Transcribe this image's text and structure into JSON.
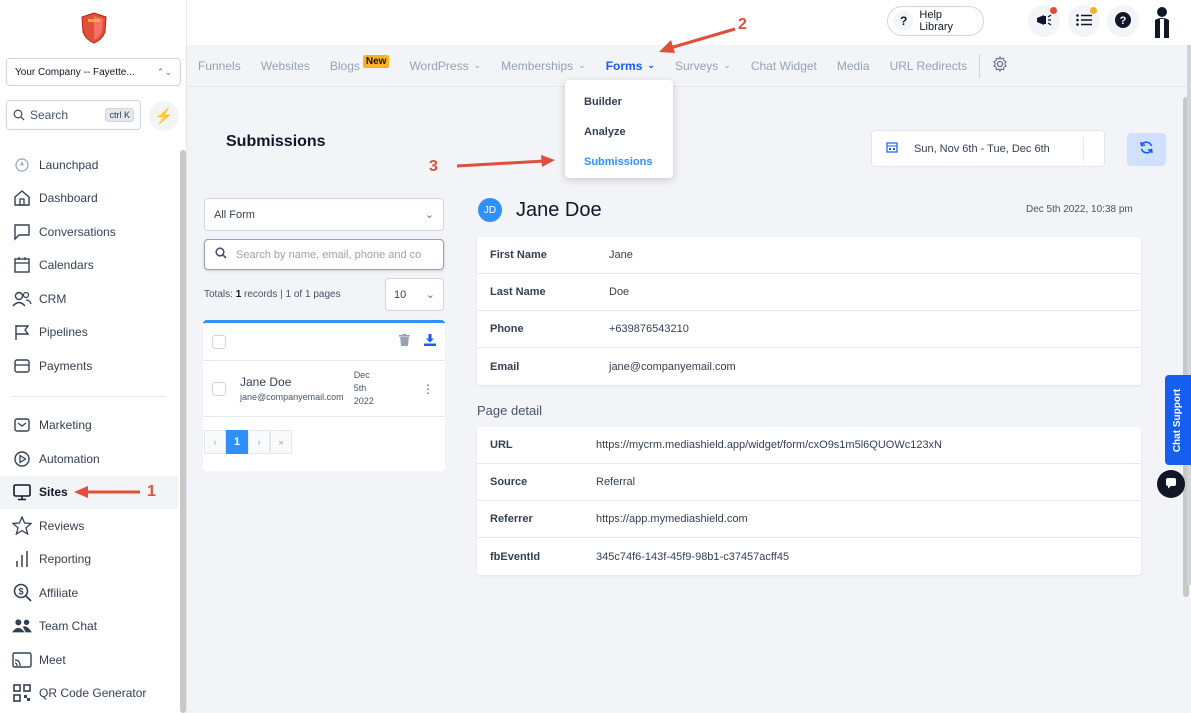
{
  "company": {
    "name": "Your Company -- Fayette..."
  },
  "search": {
    "label": "Search",
    "shortcut": "ctrl K"
  },
  "sidebar": {
    "items": [
      {
        "label": "Launchpad",
        "icon": "rocket-icon"
      },
      {
        "label": "Dashboard",
        "icon": "home-icon"
      },
      {
        "label": "Conversations",
        "icon": "chat-icon"
      },
      {
        "label": "Calendars",
        "icon": "calendar-icon"
      },
      {
        "label": "CRM",
        "icon": "users-icon"
      },
      {
        "label": "Pipelines",
        "icon": "flag-icon"
      },
      {
        "label": "Payments",
        "icon": "wallet-icon"
      }
    ],
    "items2": [
      {
        "label": "Marketing",
        "icon": "mail-icon"
      },
      {
        "label": "Automation",
        "icon": "play-icon"
      },
      {
        "label": "Sites",
        "icon": "monitor-icon",
        "active": true
      },
      {
        "label": "Reviews",
        "icon": "star-icon"
      },
      {
        "label": "Reporting",
        "icon": "bar-chart-icon"
      },
      {
        "label": "Affiliate",
        "icon": "dollar-search-icon"
      },
      {
        "label": "Team Chat",
        "icon": "team-icon"
      },
      {
        "label": "Meet",
        "icon": "cast-icon"
      },
      {
        "label": "QR Code Generator",
        "icon": "qr-icon"
      }
    ]
  },
  "topbar": {
    "help_label": "Help Library"
  },
  "subnav": {
    "items": [
      "Funnels",
      "Websites",
      "Blogs",
      "WordPress",
      "Memberships",
      "Forms",
      "Surveys",
      "Chat Widget",
      "Media",
      "URL Redirects"
    ],
    "new_badge": "New"
  },
  "forms_menu": {
    "items": [
      "Builder",
      "Analyze",
      "Submissions"
    ]
  },
  "page": {
    "title": "Submissions",
    "date_range": "Sun, Nov 6th - Tue, Dec 6th"
  },
  "filters": {
    "form_select": "All Form",
    "search_placeholder": "Search by name, email, phone and co",
    "totals_prefix": "Totals: ",
    "totals_count": "1",
    "totals_suffix": " records | 1 of 1 pages",
    "per_page": "10"
  },
  "list": {
    "rows": [
      {
        "name": "Jane Doe",
        "email": "jane@companyemail.com",
        "date_line1": "Dec",
        "date_line2": "5th",
        "date_line3": "2022"
      }
    ],
    "pager": [
      "‹",
      "1",
      "›",
      "»"
    ]
  },
  "detail": {
    "initials": "JD",
    "name": "Jane Doe",
    "date": "Dec 5th 2022, 10:38 pm",
    "fields": [
      {
        "key": "First Name",
        "value": "Jane"
      },
      {
        "key": "Last Name",
        "value": "Doe"
      },
      {
        "key": "Phone",
        "value": "+639876543210"
      },
      {
        "key": "Email",
        "value": "jane@companyemail.com"
      }
    ],
    "page_detail_label": "Page detail",
    "page_fields": [
      {
        "key": "URL",
        "value": "https://mycrm.mediashield.app/widget/form/cxO9s1m5l6QUOWc123xN"
      },
      {
        "key": "Source",
        "value": "Referral"
      },
      {
        "key": "Referrer",
        "value": "https://app.mymediashield.com"
      },
      {
        "key": "fbEventId",
        "value": "345c74f6-143f-45f9-98b1-c37457acff45"
      }
    ]
  },
  "chat": {
    "label": "Chat Support"
  },
  "annotations": {
    "step1": "1",
    "step2": "2",
    "step3": "3"
  },
  "colors": {
    "accent": "#155eef",
    "annotation": "#e04f39",
    "badge": "#fdb022"
  }
}
